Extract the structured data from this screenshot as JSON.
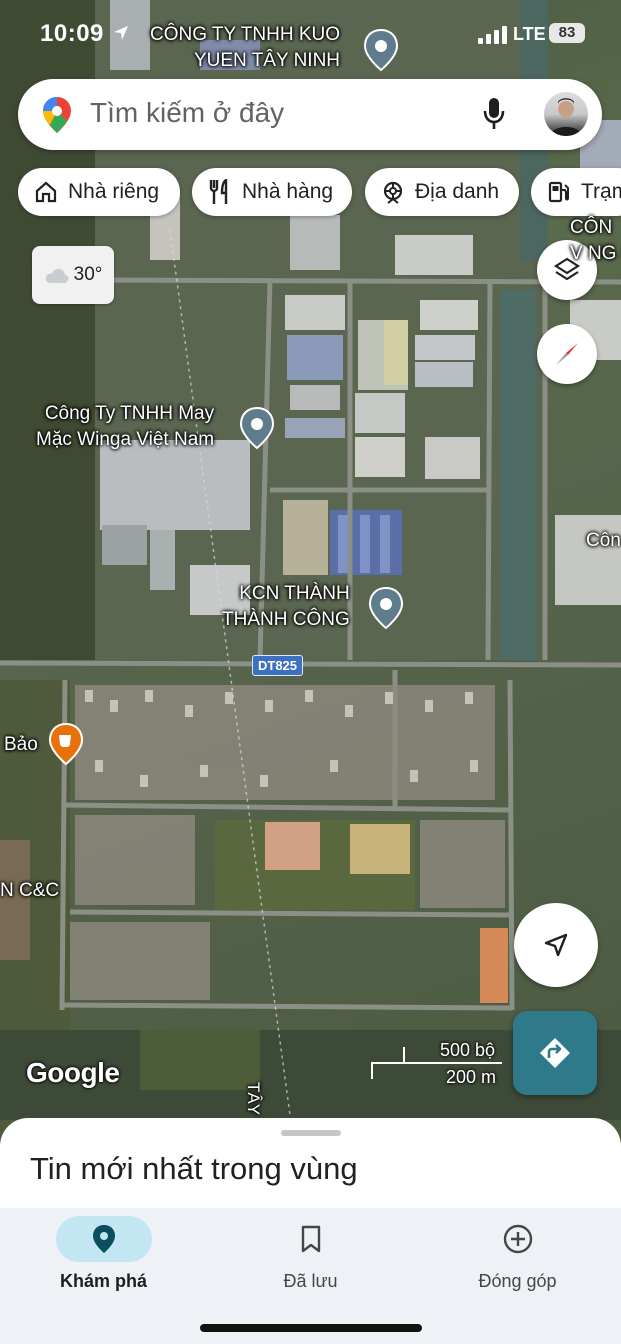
{
  "status_bar": {
    "time": "10:09",
    "network": "LTE",
    "battery": "83"
  },
  "search": {
    "placeholder": "Tìm kiếm ở đây"
  },
  "chips": [
    {
      "label": "Nhà riêng",
      "icon": "home-icon"
    },
    {
      "label": "Nhà hàng",
      "icon": "restaurant-icon"
    },
    {
      "label": "Địa danh",
      "icon": "landmark-icon"
    },
    {
      "label": "Trạm",
      "icon": "gas-station-icon"
    }
  ],
  "weather": {
    "temperature": "30°",
    "icon": "cloud-icon"
  },
  "map": {
    "labels": {
      "kuo": [
        "CÔNG TY TNHH KUO",
        "YUEN TÂY NINH"
      ],
      "winga": [
        "Công Ty TNHH May",
        "Mặc Winga Việt Nam"
      ],
      "kcn": [
        "KCN THÀNH",
        "THÀNH CÔNG"
      ],
      "bao": "Bảo",
      "cc": "N C&C",
      "cong_top": [
        "CÔN",
        "V NG I"
      ],
      "con_mid": "Côn",
      "tay": "TÂY"
    },
    "road_shield": "DT825",
    "google_logo": "Google",
    "scale": {
      "imperial": "500 bộ",
      "metric": "200 m"
    },
    "colors": {
      "pin": "#5f7c8c",
      "cafe": "#e8710a",
      "directions": "#2f7a8a"
    }
  },
  "sheet": {
    "title": "Tin mới nhất trong vùng"
  },
  "nav": [
    {
      "label": "Khám phá",
      "icon": "explore-pin-icon",
      "active": true
    },
    {
      "label": "Đã lưu",
      "icon": "bookmark-icon",
      "active": false
    },
    {
      "label": "Đóng góp",
      "icon": "add-circle-icon",
      "active": false
    }
  ]
}
